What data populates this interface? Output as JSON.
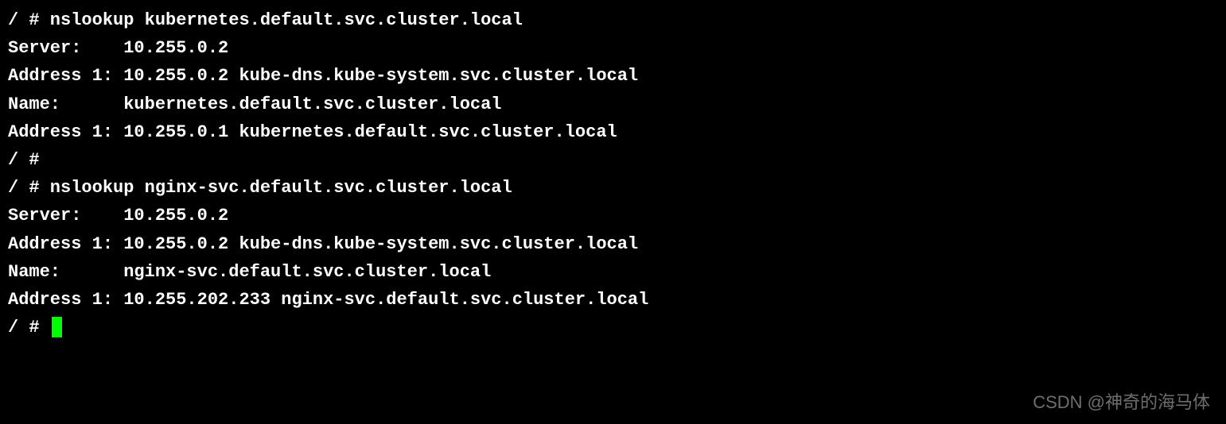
{
  "terminal": {
    "lines": [
      "/ # nslookup kubernetes.default.svc.cluster.local",
      "Server:    10.255.0.2",
      "Address 1: 10.255.0.2 kube-dns.kube-system.svc.cluster.local",
      "",
      "Name:      kubernetes.default.svc.cluster.local",
      "Address 1: 10.255.0.1 kubernetes.default.svc.cluster.local",
      "/ #",
      "/ # nslookup nginx-svc.default.svc.cluster.local",
      "Server:    10.255.0.2",
      "Address 1: 10.255.0.2 kube-dns.kube-system.svc.cluster.local",
      "",
      "Name:      nginx-svc.default.svc.cluster.local",
      "Address 1: 10.255.202.233 nginx-svc.default.svc.cluster.local"
    ],
    "prompt_final": "/ # "
  },
  "watermark": "CSDN @神奇的海马体"
}
